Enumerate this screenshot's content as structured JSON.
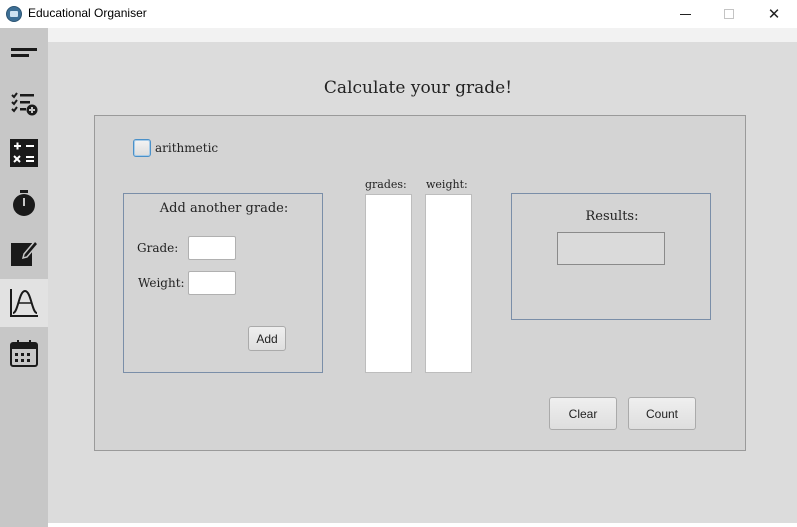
{
  "window": {
    "title": "Educational Organiser",
    "minimize": "—",
    "maximize": "□",
    "close": "✕"
  },
  "sidebar": {
    "items": [
      {
        "icon": "menu-icon",
        "active": false
      },
      {
        "icon": "task-list-add-icon",
        "active": false
      },
      {
        "icon": "calculator-icon",
        "active": false
      },
      {
        "icon": "stopwatch-icon",
        "active": false
      },
      {
        "icon": "edit-note-icon",
        "active": false
      },
      {
        "icon": "grade-curve-icon",
        "active": true
      },
      {
        "icon": "calendar-icon",
        "active": false
      }
    ]
  },
  "main": {
    "title": "Calculate your grade!",
    "arithmetic": {
      "label": "arithmetic",
      "checked": false
    },
    "add_grade": {
      "title": "Add another grade:",
      "grade_label": "Grade:",
      "grade_value": "",
      "weight_label": "Weight:",
      "weight_value": "",
      "add_button": "Add"
    },
    "lists": {
      "grades_label": "grades:",
      "weight_label": "weight:",
      "grades": [],
      "weights": []
    },
    "results": {
      "title": "Results:",
      "value": ""
    },
    "buttons": {
      "clear": "Clear",
      "count": "Count"
    }
  },
  "colors": {
    "sidebar_bg": "#c7c7c7",
    "main_bg": "#dcdcdc",
    "panel_bg": "#d4d4d4",
    "box_border": "#7a8ea8",
    "checkbox_focus": "#4a90c8"
  }
}
